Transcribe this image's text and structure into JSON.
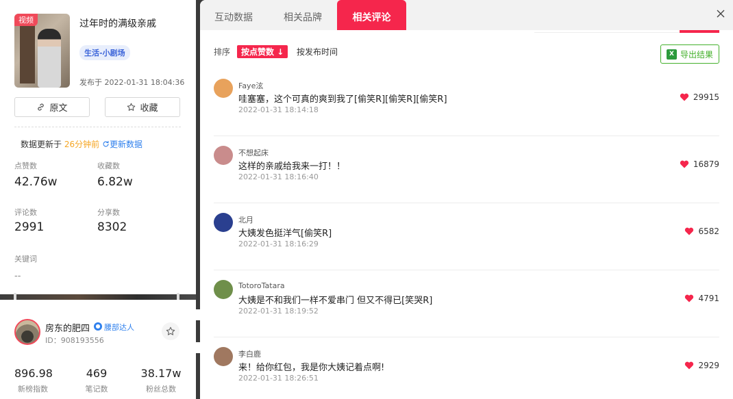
{
  "video": {
    "tag": "视频",
    "title": "过年时的满级亲戚",
    "category": "生活-小剧场",
    "published": "发布于 2022-01-31 18:04:36",
    "btn_original": "原文",
    "btn_favorite": "收藏"
  },
  "update": {
    "prefix": "数据更新于 ",
    "ago": "26分钟前",
    "refresh": "更新数据"
  },
  "stats": {
    "likes_label": "点赞数",
    "likes": "42.76w",
    "collects_label": "收藏数",
    "collects": "6.82w",
    "comments_label": "评论数",
    "comments": "2991",
    "shares_label": "分享数",
    "shares": "8302",
    "keywords_label": "关键词",
    "keywords": "--"
  },
  "author": {
    "name": "房东的肥四",
    "badge": "腰部达人",
    "id": "ID：908193556",
    "index": "896.98",
    "index_label": "新榜指数",
    "notes": "469",
    "notes_label": "笔记数",
    "fans": "38.17w",
    "fans_label": "粉丝总数"
  },
  "tabs": [
    {
      "label": "互动数据"
    },
    {
      "label": "相关品牌"
    },
    {
      "label": "相关评论"
    }
  ],
  "sort": {
    "label": "排序",
    "active": "按点赞数",
    "other": "按发布时间",
    "export": "导出结果"
  },
  "comments": [
    {
      "name": "Faye泫",
      "text": "哇塞塞，这个可真的爽到我了[偷笑R][偷笑R][偷笑R]",
      "time": "2022-01-31 18:14:18",
      "likes": "29915",
      "avatar_color": "#e8a25c"
    },
    {
      "name": "不想起床",
      "text": "这样的亲戚给我来一打！！",
      "time": "2022-01-31 18:16:40",
      "likes": "16879",
      "avatar_color": "#c98c8c"
    },
    {
      "name": "北月",
      "text": "大姨发色挺洋气[偷笑R]",
      "time": "2022-01-31 18:16:29",
      "likes": "6582",
      "avatar_color": "#2a3f8f"
    },
    {
      "name": "TotoroTatara",
      "text": "大姨是不和我们一样不爱串门 但又不得已[笑哭R]",
      "time": "2022-01-31 18:19:52",
      "likes": "4791",
      "avatar_color": "#6f8f4a"
    },
    {
      "name": "李白鹿",
      "text": "来！给你红包，我是你大姨记着点啊!",
      "time": "2022-01-31 18:26:51",
      "likes": "2929",
      "avatar_color": "#a07860"
    }
  ],
  "colors": {
    "accent": "#f5264c",
    "export_green": "#43b02a",
    "link_blue": "#2f80ed",
    "ago_orange": "#f5a623"
  }
}
